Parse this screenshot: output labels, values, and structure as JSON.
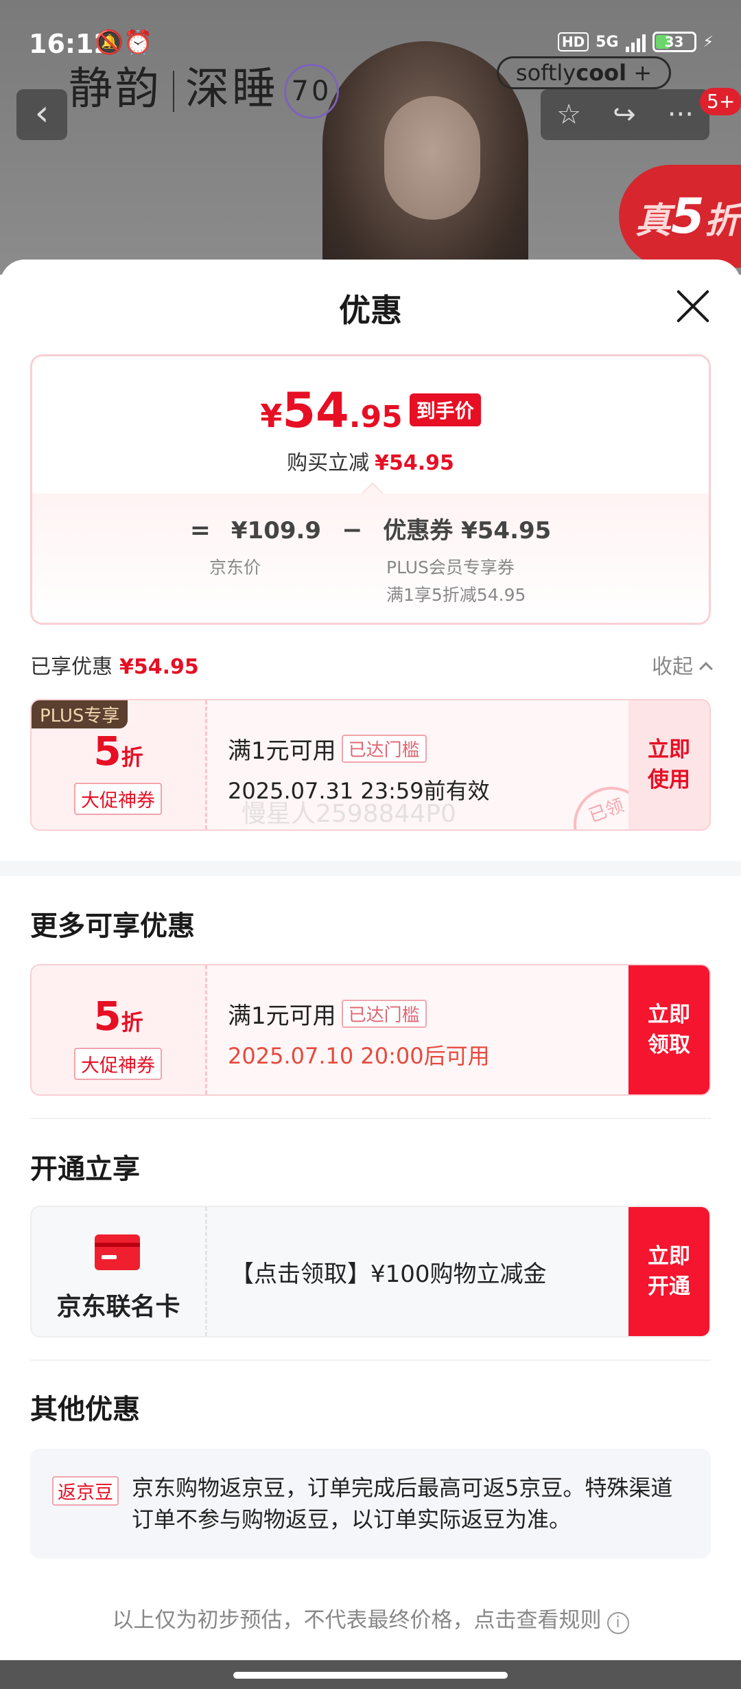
{
  "status_bar": {
    "time": "16:12",
    "left_icons": "🔕⏰",
    "hd": "HD",
    "network": "5G",
    "battery": "33",
    "charging": "⚡"
  },
  "background": {
    "brand_1": "静韵",
    "brand_2": "深睡",
    "brand_num": "70",
    "softly_pre": "softly",
    "softly_bold": "cool",
    "softly_plus": "+",
    "back_glyph": "‹",
    "star_glyph": "☆",
    "share_glyph": "↪",
    "more_glyph": "···",
    "badge": "5+",
    "sale_prefix": "真",
    "sale_num": "5",
    "sale_suffix": "折"
  },
  "sheet": {
    "title": "优惠"
  },
  "price_card": {
    "yen": "¥",
    "int": "54",
    "dec": ".95",
    "tag": "到手价",
    "sub_label": "购买立减",
    "sub_value": "¥54.95",
    "eq": "=",
    "jd_price": "¥109.9",
    "minus": "−",
    "coupon_label": "优惠券",
    "coupon_value": "¥54.95",
    "jd_price_label": "京东价",
    "coupon_desc_1": "PLUS会员专享券",
    "coupon_desc_2": "满1享5折减54.95"
  },
  "enjoyed": {
    "label": "已享优惠",
    "value": "¥54.95",
    "collapse": "收起"
  },
  "coupon_1": {
    "plus_tag": "PLUS专享",
    "discount": "5",
    "unit": "折",
    "kind": "大促神券",
    "condition": "满1元可用",
    "reached": "已达门槛",
    "validity": "2025.07.31 23:59前有效",
    "watermark": "慢星人2598844P0",
    "stamp": "已领",
    "button_1": "立即",
    "button_2": "使用"
  },
  "more_section": {
    "title": "更多可享优惠"
  },
  "coupon_2": {
    "discount": "5",
    "unit": "折",
    "kind": "大促神券",
    "condition": "满1元可用",
    "reached": "已达门槛",
    "validity": "2025.07.10 20:00后可用",
    "button_1": "立即",
    "button_2": "领取"
  },
  "open_section": {
    "title": "开通立享"
  },
  "card_offer": {
    "name": "京东联名卡",
    "text": "【点击领取】¥100购物立减金",
    "button_1": "立即",
    "button_2": "开通"
  },
  "other_section": {
    "title": "其他优惠",
    "tag": "返京豆",
    "text": "京东购物返京豆，订单完成后最高可返5京豆。特殊渠道订单不参与购物返豆，以订单实际返豆为准。"
  },
  "footnote": {
    "text": "以上仅为初步预估，不代表最终价格，点击查看规则",
    "info_glyph": "i"
  },
  "colors": {
    "accent_red": "#e60f24",
    "button_red": "#f5152f",
    "plus_brown": "#5b3f2f"
  }
}
